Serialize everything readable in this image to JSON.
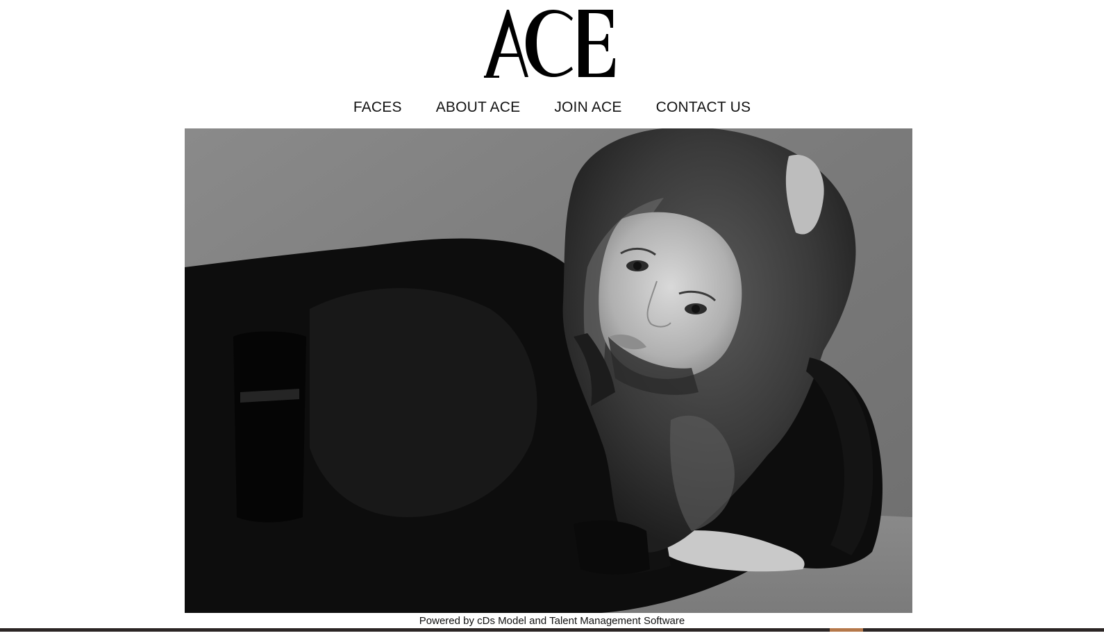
{
  "brand": {
    "logo_text": "ACE"
  },
  "nav": {
    "items": [
      {
        "label": "FACES"
      },
      {
        "label": "ABOUT ACE"
      },
      {
        "label": "JOIN ACE"
      },
      {
        "label": "CONTACT US"
      }
    ]
  },
  "hero": {
    "style": "black-and-white portrait photo"
  },
  "footer": {
    "powered_by": "Powered by cDs Model and Talent Management Software"
  },
  "colors": {
    "background": "#ffffff",
    "text": "#111111",
    "bottom_bar": "#2b2524",
    "bottom_bar_accent": "#b5784a"
  }
}
